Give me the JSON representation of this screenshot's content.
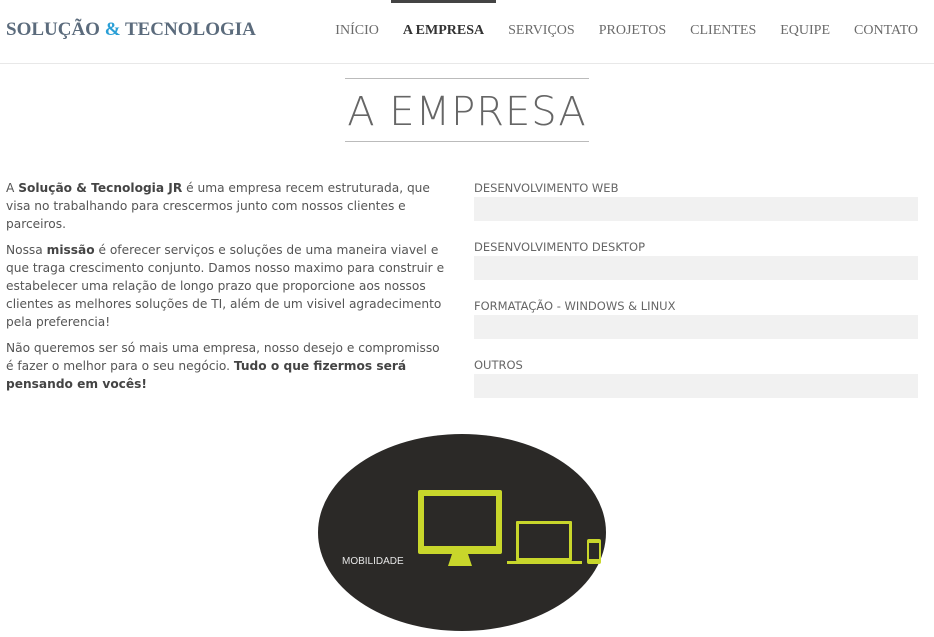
{
  "brand": {
    "part1": "SOLUÇÃO ",
    "amp": "&",
    "part2": " TECNOLOGIA"
  },
  "nav": {
    "items": [
      {
        "label": "INÍCIO",
        "active": false
      },
      {
        "label": "A EMPRESA",
        "active": true
      },
      {
        "label": "SERVIÇOS",
        "active": false
      },
      {
        "label": "PROJETOS",
        "active": false
      },
      {
        "label": "CLIENTES",
        "active": false
      },
      {
        "label": "EQUIPE",
        "active": false
      },
      {
        "label": "CONTATO",
        "active": false
      }
    ]
  },
  "section": {
    "title": "A EMPRESA"
  },
  "about": {
    "p1_pre": "A ",
    "p1_strong": "Solução & Tecnologia JR",
    "p1_post": " é uma empresa recem estruturada, que visa no trabalhando para crescermos junto com nossos clientes e parceiros.",
    "p2_pre": "Nossa ",
    "p2_strong": "missão",
    "p2_post": " é oferecer serviços e soluções de uma maneira viavel e que traga crescimento conjunto. Damos nosso maximo para construir e estabelecer uma relação de longo prazo que proporcione aos nossos clientes as melhores soluções de TI, além de um visivel agradecimento pela preferencia!",
    "p3_pre": "Não queremos ser só mais uma empresa, nosso desejo e compromisso é fazer o melhor para o seu negócio. ",
    "p3_strong": "Tudo o que fizermos será pensando em vocês!"
  },
  "skills": [
    {
      "label": "DESENVOLVIMENTO WEB"
    },
    {
      "label": "DESENVOLVIMENTO DESKTOP"
    },
    {
      "label": "FORMATAÇÃO - WINDOWS & LINUX"
    },
    {
      "label": "OUTROS"
    }
  ],
  "image": {
    "caption": "MOBILIDADE",
    "background_color": "#2b2927",
    "accent_color": "#c8d62b"
  }
}
